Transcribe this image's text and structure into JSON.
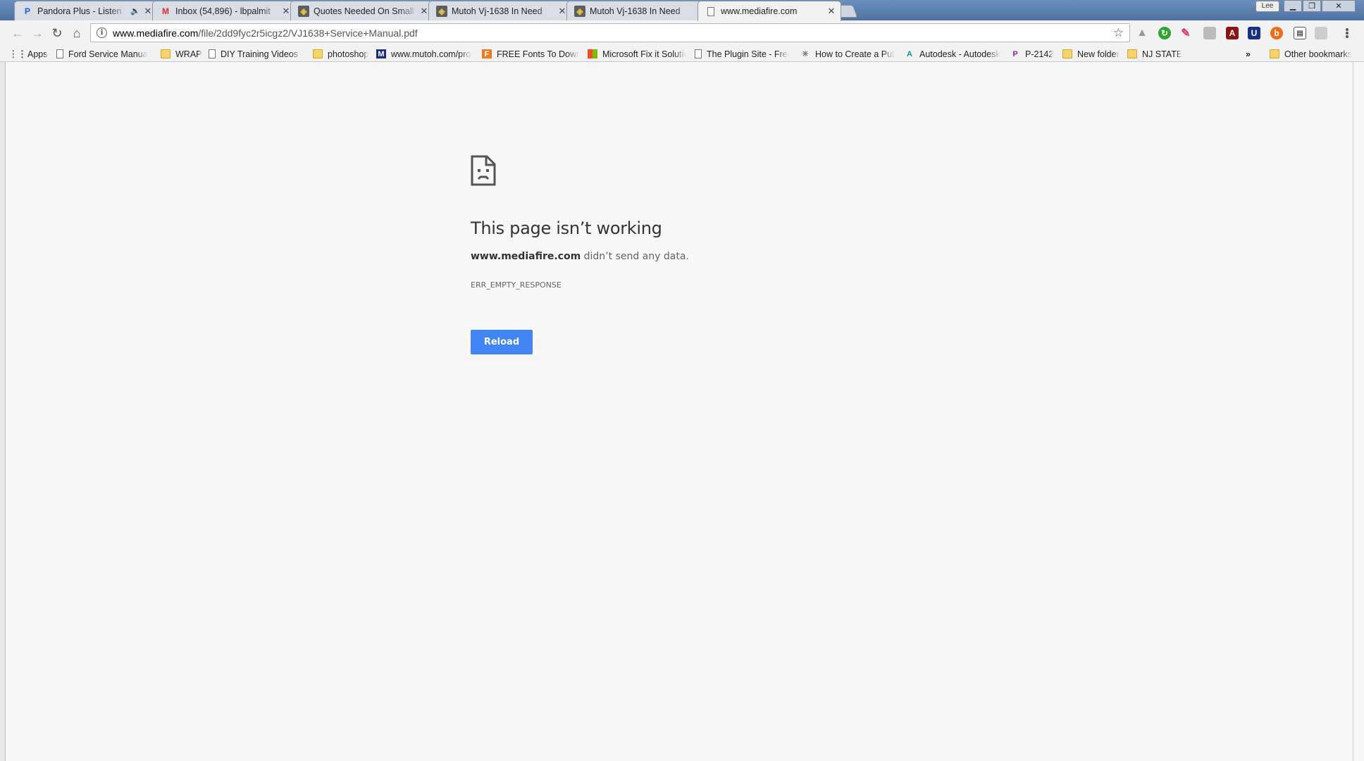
{
  "tabs": [
    {
      "title": "Pandora Plus - Listen",
      "icon": "pandora-icon",
      "audio": "🔈"
    },
    {
      "title": "Inbox (54,896) - lbpalmit",
      "icon": "gmail-icon"
    },
    {
      "title": "Quotes Needed On Small",
      "icon": "forum-icon"
    },
    {
      "title": "Mutoh Vj-1638 In Need",
      "icon": "forum-icon"
    },
    {
      "title": "Mutoh Vj-1638 In Need",
      "icon": "forum-icon"
    },
    {
      "title": "www.mediafire.com",
      "icon": "page-icon"
    }
  ],
  "window": {
    "profile": "Lee"
  },
  "toolbar": {
    "url_host": "www.mediafire.com",
    "url_path": "/file/2dd9fyc2r5icgz2/VJ1638+Service+Manual.pdf"
  },
  "bookmarks": {
    "items": [
      {
        "label": "Apps",
        "icon": "apps-icon"
      },
      {
        "label": "Ford Service Manuals",
        "icon": "page-icon"
      },
      {
        "label": "WRAP",
        "icon": "folder-icon"
      },
      {
        "label": "DIY Training Videos -",
        "icon": "page-icon"
      },
      {
        "label": "photoshop",
        "icon": "folder-icon"
      },
      {
        "label": "www.mutoh.com/prod",
        "icon": "mutoh-icon"
      },
      {
        "label": "FREE Fonts To Downlo",
        "icon": "fonts-icon"
      },
      {
        "label": "Microsoft Fix it Solutio",
        "icon": "microsoft-icon"
      },
      {
        "label": "The Plugin Site - Free",
        "icon": "page-icon"
      },
      {
        "label": "How to Create a Publi",
        "icon": "site-icon"
      },
      {
        "label": "Autodesk - Autodesk",
        "icon": "autodesk-icon"
      },
      {
        "label": "P-2142",
        "icon": "p-icon"
      },
      {
        "label": "New folder",
        "icon": "folder-icon"
      },
      {
        "label": "NJ STATE",
        "icon": "folder-icon"
      }
    ],
    "overflow": "»",
    "other": "Other bookmarks"
  },
  "error": {
    "title": "This page isn’t working",
    "host": "www.mediafire.com",
    "message": " didn’t send any data.",
    "code": "ERR_EMPTY_RESPONSE",
    "reload_label": "Reload"
  },
  "colors": {
    "accent": "#4285f4",
    "background": "#f7f7f7"
  }
}
